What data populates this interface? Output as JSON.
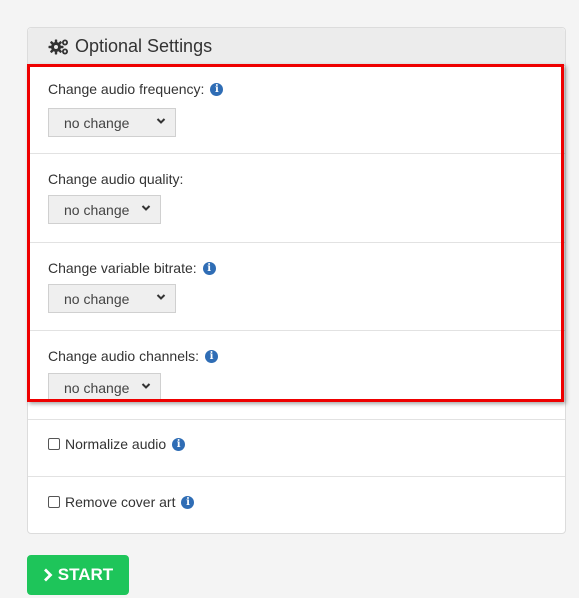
{
  "panel": {
    "title": "Optional Settings",
    "icon": "gears-icon"
  },
  "settings": [
    {
      "label": "Change audio frequency:",
      "has_info": true,
      "value": "no change",
      "icon": "info-icon"
    },
    {
      "label": "Change audio quality:",
      "has_info": false,
      "value": "no change"
    },
    {
      "label": "Change variable bitrate:",
      "has_info": true,
      "value": "no change",
      "icon": "info-icon"
    },
    {
      "label": "Change audio channels:",
      "has_info": true,
      "value": "no change",
      "icon": "info-icon"
    }
  ],
  "checkboxes": [
    {
      "label": "Normalize audio",
      "checked": false,
      "icon": "info-icon"
    },
    {
      "label": "Remove cover art",
      "checked": false,
      "icon": "info-icon"
    }
  ],
  "info_glyph": "i",
  "start_button": {
    "label": "START",
    "icon": "chevron-right-icon"
  },
  "colors": {
    "accent_green": "#1ec55a",
    "info_blue": "#2f6db5",
    "highlight_red": "#ee0000"
  }
}
